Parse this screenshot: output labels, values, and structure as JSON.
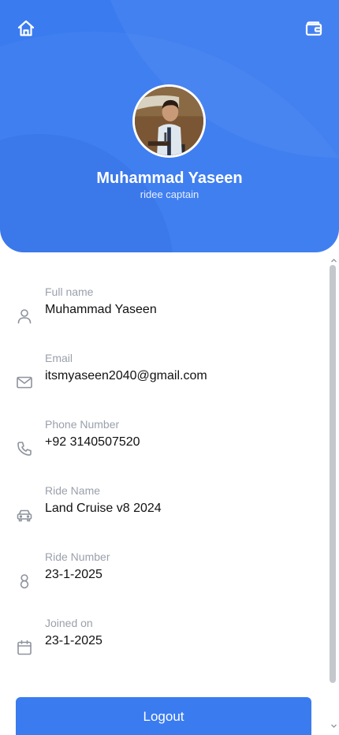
{
  "header": {
    "home_icon": "home-icon",
    "wallet_icon": "wallet-icon",
    "colors": {
      "primary": "#3a7bf0",
      "text_on_primary": "#ffffff"
    }
  },
  "profile": {
    "name": "Muhammad Yaseen",
    "role": "ridee captain"
  },
  "fields": [
    {
      "icon": "user-icon",
      "label": "Full name",
      "value": "Muhammad Yaseen"
    },
    {
      "icon": "mail-icon",
      "label": "Email",
      "value": "itsmyaseen2040@gmail.com"
    },
    {
      "icon": "phone-icon",
      "label": "Phone Number",
      "value": "+92 3140507520"
    },
    {
      "icon": "car-icon",
      "label": "Ride Name",
      "value": "Land Cruise v8 2024"
    },
    {
      "icon": "number-eight-icon",
      "label": "Ride Number",
      "value": "23-1-2025"
    },
    {
      "icon": "calendar-icon",
      "label": "Joined on",
      "value": "23-1-2025"
    }
  ],
  "actions": {
    "logout_label": "Logout"
  }
}
